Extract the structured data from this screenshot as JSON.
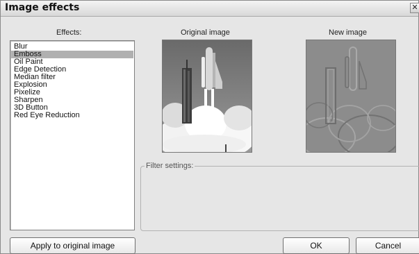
{
  "window": {
    "title": "Image effects",
    "close_glyph": "✕"
  },
  "effects": {
    "label": "Effects:",
    "items": [
      {
        "label": "Blur",
        "selected": false
      },
      {
        "label": "Emboss",
        "selected": true
      },
      {
        "label": "Oil Paint",
        "selected": false
      },
      {
        "label": "Edge Detection",
        "selected": false
      },
      {
        "label": "Median filter",
        "selected": false
      },
      {
        "label": "Explosion",
        "selected": false
      },
      {
        "label": "Pixelize",
        "selected": false
      },
      {
        "label": "Sharpen",
        "selected": false
      },
      {
        "label": "3D Button",
        "selected": false
      },
      {
        "label": "Red Eye Reduction",
        "selected": false
      }
    ]
  },
  "preview": {
    "original_label": "Original image",
    "new_label": "New image"
  },
  "filter_settings": {
    "label": "Filter settings:"
  },
  "buttons": {
    "apply": "Apply to original image",
    "ok": "OK",
    "cancel": "Cancel"
  },
  "colors": {
    "selection": "#b0b0b0",
    "window_bg": "#e6e6e6"
  }
}
